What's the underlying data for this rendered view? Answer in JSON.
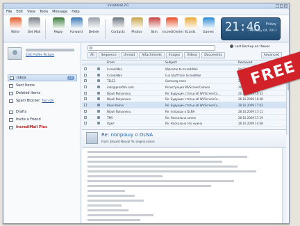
{
  "window": {
    "title": "Incredimail 2.0"
  },
  "menu": [
    "File",
    "Edit",
    "View",
    "Tools",
    "Message",
    "Help"
  ],
  "toolbar": [
    {
      "label": "Write",
      "icon": "write-icon",
      "color": "#e45b2c"
    },
    {
      "label": "Get Mail",
      "icon": "get-mail-icon",
      "color": "#7a7f87"
    },
    {
      "label": "Reply",
      "icon": "reply-icon",
      "color": "#3a7a3c"
    },
    {
      "label": "Forward",
      "icon": "forward-icon",
      "color": "#3a78b7"
    },
    {
      "label": "Delete",
      "icon": "delete-icon",
      "color": "#9aa1aa"
    },
    {
      "label": "Contacts",
      "icon": "contacts-icon",
      "color": "#6d7580"
    },
    {
      "label": "Photos",
      "icon": "photos-icon",
      "color": "#c9a548"
    },
    {
      "label": "Skin",
      "icon": "skin-icon",
      "color": "#c0433f"
    },
    {
      "label": "IncrediCenter",
      "icon": "incredicenter-icon",
      "color": "#e84f2a"
    },
    {
      "label": "Ecards",
      "icon": "ecards-icon",
      "color": "#e7a93b"
    },
    {
      "label": "Games",
      "icon": "games-icon",
      "color": "#2e8ad1"
    }
  ],
  "clock": {
    "time": "21:46",
    "day": "Friday",
    "date": "February 04, 2011"
  },
  "profile": {
    "edit_link": "Edit Profile Picture"
  },
  "folders": [
    {
      "label": "Inbox",
      "count": "10",
      "active": true
    },
    {
      "label": "Sent Items"
    },
    {
      "label": "Deleted Items"
    },
    {
      "label": "Spam Blocker",
      "link": "Turn On"
    },
    {
      "gap": true
    },
    {
      "label": "Drafts"
    },
    {
      "label": "Invite a Friend"
    },
    {
      "label": "IncrediMail Plus",
      "highlight": true
    }
  ],
  "search": {
    "placeholder": ""
  },
  "backup_label": "Last Backup on: Never",
  "filters": [
    "All",
    "Sequence",
    "Unread",
    "Attachments",
    "Images",
    "Videos",
    "Documents",
    "Advanced"
  ],
  "columns": {
    "from": "From",
    "subject": "Subject",
    "received": "Received"
  },
  "messages": [
    {
      "from": "IncrediMail",
      "subject": "Welcome to IncrediMail",
      "date": "04.02.2011 22:45"
    },
    {
      "from": "IncrediMail",
      "subject": "Fun Stuff from IncrediMail",
      "date": "04.02.2011 22:44"
    },
    {
      "from": "TELE2",
      "subject": "Samsung поле",
      "date": "22.12.2009 15:59"
    },
    {
      "from": "mail@proxfilm.com",
      "subject": "Регистрация WVScreenCamera",
      "date": "26.09.2009 21:54"
    },
    {
      "from": "Nipuli Nulyanenu",
      "subject": "Re: Будущие статьи об WVScreenCa...",
      "date": "26.10.2009 10:33"
    },
    {
      "from": "Nipuli Nulyanenu",
      "subject": "Re: Будущие статьи об WVScreenCa...",
      "date": "26.10.2009 10:38"
    },
    {
      "from": "Pavel Kalnin",
      "subject": "Re: Будущие статьи об WVScreenCa...",
      "date": "28.10.2009 17:03",
      "selected": true
    },
    {
      "from": "Nipuli Nulyanenu",
      "subject": "Re: попрошу о DLNA",
      "date": "28.10.2009 17:11"
    },
    {
      "from": "TMS",
      "subject": "Re: Наскольно зачем",
      "date": "28.10.2009 17:19"
    },
    {
      "from": "Пдмт",
      "subject": "Re: Наскольно это нужно",
      "date": "28.10.2009 14:48"
    }
  ],
  "preview": {
    "subject": "Re: попрошу о DLNA",
    "meta": "From: Eduard Nosval    To: ongoni.ssonis"
  },
  "promo": {
    "label": "FREE",
    "color": "#d1222a"
  }
}
